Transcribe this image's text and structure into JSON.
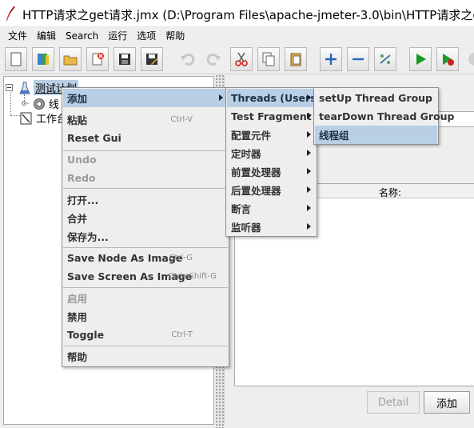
{
  "window": {
    "title": "HTTP请求之get请求.jmx (D:\\Program Files\\apache-jmeter-3.0\\bin\\HTTP请求之g"
  },
  "menubar": {
    "items": [
      "文件",
      "编辑",
      "Search",
      "运行",
      "选项",
      "帮助"
    ]
  },
  "toolbar": {
    "icons": [
      "new-icon",
      "templates-icon",
      "open-icon",
      "close-icon",
      "save-icon",
      "save-as-icon",
      "undo-icon",
      "redo-icon",
      "cut-icon",
      "copy-icon",
      "paste-icon",
      "expand-icon",
      "collapse-icon",
      "toggle-icon",
      "start-icon",
      "start-no-pause-icon",
      "stop-icon"
    ]
  },
  "tree": {
    "test_plan": "测试计划",
    "child_partial": "线",
    "workbench_partial": "工作台"
  },
  "right_panel": {
    "name_column": "名称:",
    "detail_button": "Detail",
    "add_button": "添加"
  },
  "context_menu": {
    "items": [
      {
        "label": "添加",
        "accel": "",
        "submenu": true,
        "state": "active"
      },
      {
        "label": "粘贴",
        "accel": "Ctrl-V"
      },
      {
        "label": "Reset Gui",
        "accel": ""
      },
      {
        "label": "Undo",
        "accel": "",
        "state": "disabled"
      },
      {
        "label": "Redo",
        "accel": "",
        "state": "disabled"
      },
      {
        "label": "打开...",
        "accel": ""
      },
      {
        "label": "合并",
        "accel": ""
      },
      {
        "label": "保存为...",
        "accel": ""
      },
      {
        "label": "Save Node As Image",
        "accel": "Ctrl-G"
      },
      {
        "label": "Save Screen As Image",
        "accel": "Ctrl+Shift-G"
      },
      {
        "label": "启用",
        "accel": "",
        "state": "disabled"
      },
      {
        "label": "禁用",
        "accel": ""
      },
      {
        "label": "Toggle",
        "accel": "Ctrl-T"
      },
      {
        "label": "帮助",
        "accel": ""
      }
    ]
  },
  "add_submenu": {
    "items": [
      {
        "label": "Threads (Users)",
        "state": "active"
      },
      {
        "label": "Test Fragment"
      },
      {
        "label": "配置元件"
      },
      {
        "label": "定时器"
      },
      {
        "label": "前置处理器"
      },
      {
        "label": "后置处理器"
      },
      {
        "label": "断言"
      },
      {
        "label": "监听器"
      }
    ]
  },
  "threads_submenu": {
    "items": [
      {
        "label": "setUp Thread Group"
      },
      {
        "label": "tearDown Thread Group"
      },
      {
        "label": "线程组",
        "state": "active"
      }
    ]
  },
  "colors": {
    "menu_highlight": "#b8cfe5",
    "menu_background": "#eeeeee",
    "start_green": "#1a9a2a",
    "stop_red": "#cc2222"
  }
}
